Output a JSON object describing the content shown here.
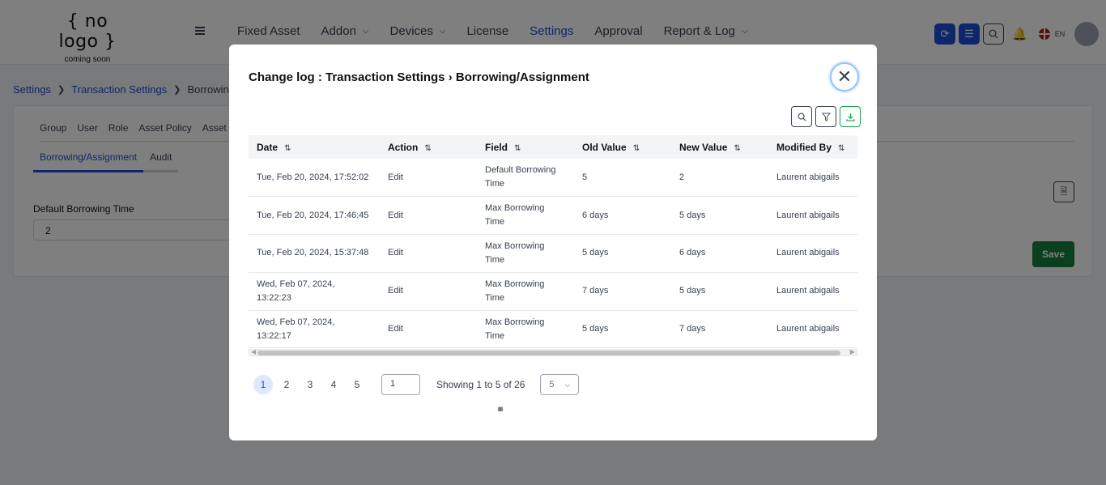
{
  "logo": {
    "line1": "{ no logo }",
    "line2": "coming soon"
  },
  "nav": {
    "items": [
      {
        "label": "Fixed Asset",
        "dropdown": false,
        "active": false
      },
      {
        "label": "Addon",
        "dropdown": true,
        "active": false
      },
      {
        "label": "Devices",
        "dropdown": true,
        "active": false
      },
      {
        "label": "License",
        "dropdown": false,
        "active": false
      },
      {
        "label": "Settings",
        "dropdown": false,
        "active": true
      },
      {
        "label": "Approval",
        "dropdown": false,
        "active": false
      },
      {
        "label": "Report & Log",
        "dropdown": true,
        "active": false
      }
    ],
    "language": "EN"
  },
  "breadcrumb": {
    "items": [
      "Settings",
      "Transaction Settings",
      "Borrowing/Assignment"
    ]
  },
  "page": {
    "tabs_main": [
      "Group",
      "User",
      "Role",
      "Asset Policy",
      "Asset"
    ],
    "tabs_sub": [
      "Borrowing/Assignment",
      "Audit"
    ],
    "field_label": "Default Borrowing Time",
    "field_value": "2",
    "save_label": "Save"
  },
  "modal": {
    "title": "Change log : Transaction Settings › Borrowing/Assignment",
    "columns": [
      "Date",
      "Action",
      "Field",
      "Old Value",
      "New Value",
      "Modified By"
    ],
    "rows": [
      [
        "Tue, Feb 20, 2024, 17:52:02",
        "Edit",
        "Default Borrowing Time",
        "5",
        "2",
        "Laurent abigails"
      ],
      [
        "Tue, Feb 20, 2024, 17:46:45",
        "Edit",
        "Max Borrowing Time",
        "6 days",
        "5 days",
        "Laurent abigails"
      ],
      [
        "Tue, Feb 20, 2024, 15:37:48",
        "Edit",
        "Max Borrowing Time",
        "5 days",
        "6 days",
        "Laurent abigails"
      ],
      [
        "Wed, Feb 07, 2024, 13:22:23",
        "Edit",
        "Max Borrowing Time",
        "7 days",
        "5 days",
        "Laurent abigails"
      ],
      [
        "Wed, Feb 07, 2024, 13:22:17",
        "Edit",
        "Max Borrowing Time",
        "5 days",
        "7 days",
        "Laurent abigails"
      ]
    ],
    "pagination": {
      "pages": [
        "1",
        "2",
        "3",
        "4",
        "5"
      ],
      "current": "1",
      "goto_value": "1",
      "info": "Showing 1 to 5 of 26",
      "page_size": "5"
    }
  },
  "colors": {
    "primary": "#1d4ed8",
    "save": "#15803d",
    "overlay": "rgba(0,0,0,0.5)"
  }
}
